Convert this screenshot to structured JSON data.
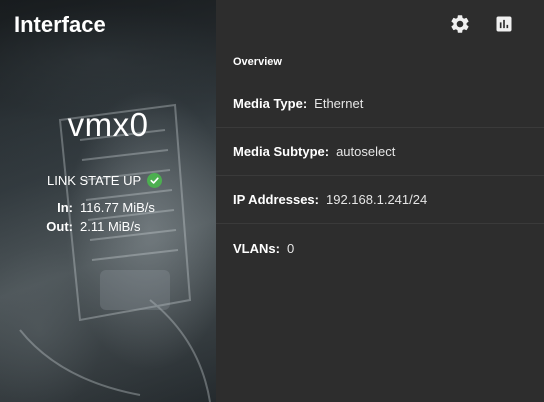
{
  "left": {
    "title": "Interface",
    "interface_name": "vmx0",
    "link_state": "LINK STATE UP",
    "traffic": [
      {
        "label": "In:",
        "value": "116.77 MiB/s"
      },
      {
        "label": "Out:",
        "value": "2.11 MiB/s"
      }
    ]
  },
  "right": {
    "toolbar": [
      {
        "icon": "gear-icon"
      },
      {
        "icon": "bar-chart-icon"
      }
    ],
    "section_title": "Overview",
    "rows": [
      {
        "label": "Media Type:",
        "value": "Ethernet"
      },
      {
        "label": "Media Subtype:",
        "value": "autoselect"
      },
      {
        "label": "IP Addresses:",
        "value": "192.168.1.241/24"
      },
      {
        "label": "VLANs:",
        "value": "0"
      }
    ]
  },
  "colors": {
    "status_ok": "#4caf50",
    "panel_bg": "#2d2d2d"
  }
}
